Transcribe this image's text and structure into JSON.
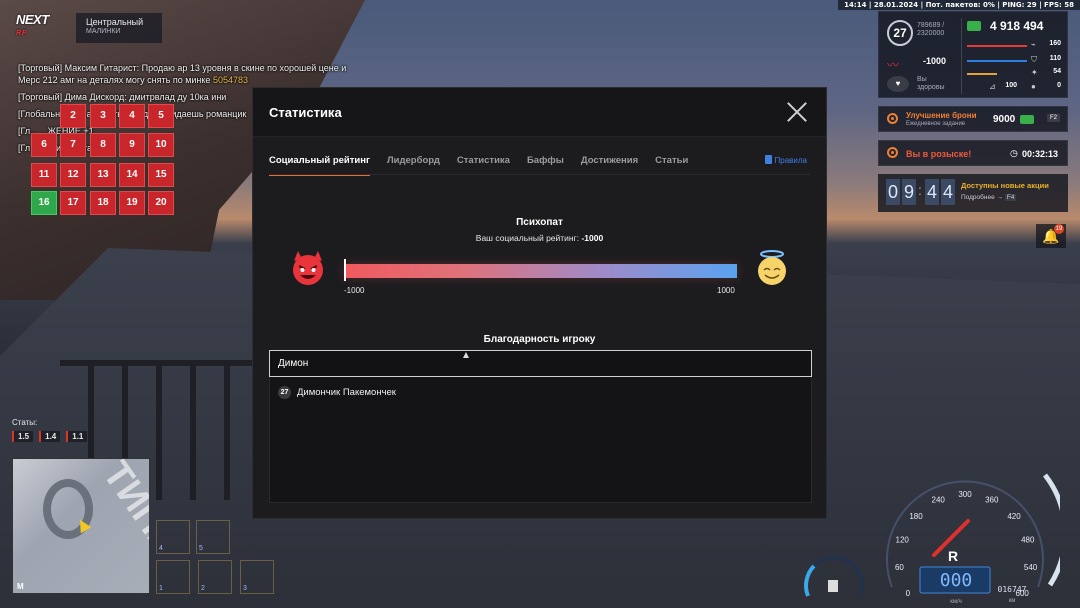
{
  "topbar": {
    "text": "14:14 | 28.01.2024 | Пот. пакетов: 0% | PING: 29 | FPS: 58"
  },
  "logo": {
    "text": "NEXT",
    "sub": "RP"
  },
  "location": {
    "name": "Центральный",
    "district": "МАЛИНКИ"
  },
  "chat": [
    {
      "text": "[Торговый] Максим Гитарист: Продаю ар 13 уровня в скине по хорошей цене и Мерс 212 амг на деталях могу снять по минке ",
      "highlight": "5054783"
    },
    {
      "text": "[Торговый] Дима Дискорд: дмитрвлад ду 10ка ини",
      "highlight": ""
    },
    {
      "text": "[Глобальный] ... атрий ты три дня у кидаешь романцик",
      "highlight": ""
    },
    {
      "text": "[Гл... ...ЖЕНИЕ +1",
      "highlight": ""
    },
    {
      "text": "[Гл... ...ский поставил",
      "highlight": ""
    }
  ],
  "advent": {
    "days": [
      "2",
      "3",
      "4",
      "5",
      "6",
      "7",
      "8",
      "9",
      "10",
      "11",
      "12",
      "13",
      "14",
      "15",
      "16",
      "17",
      "18",
      "19",
      "20"
    ],
    "active_day": "16"
  },
  "stats_left": {
    "label": "Статы:",
    "values": [
      "1.5",
      "1.4",
      "1.1"
    ]
  },
  "minimap": {
    "letter": "М",
    "map_text": "ТИПАЛ"
  },
  "hotkeys": [
    "4",
    "5",
    "1",
    "2",
    "3"
  ],
  "hud": {
    "level": "27",
    "xp": "789689 /",
    "xp_total": "2320000",
    "reputation": "-1000",
    "health_label": "Вы",
    "health_state": "здоровы",
    "money": "4 918 494",
    "stat1": "160",
    "stat2": "110",
    "stat3": "54",
    "stat4": "100",
    "stat5": "0",
    "accent": "#f08033",
    "money_color": "#38b04a"
  },
  "cards": {
    "armor_title": "Улучшение брони",
    "armor_sub": "Ежедневное задание",
    "armor_reward": "9000",
    "armor_key": "F2",
    "wanted_title": "Вы в розыске!",
    "wanted_time": "00:32:13"
  },
  "timer": {
    "digits": [
      "0",
      "9",
      "4",
      "4"
    ],
    "promo_title": "Доступны новые акции",
    "promo_sub": "Подробнее →",
    "promo_key": "F4"
  },
  "bell": {
    "count": "19"
  },
  "speedometer": {
    "ticks": [
      "0",
      "60",
      "120",
      "180",
      "240",
      "300",
      "360",
      "420",
      "480",
      "540",
      "600"
    ],
    "gear": "R",
    "speed": "000",
    "speed_unit": "км/ч",
    "odometer": "016747",
    "odometer_unit": "км"
  },
  "modal": {
    "title": "Статистика",
    "tabs": [
      "Социальный рейтинг",
      "Лидерборд",
      "Статистика",
      "Баффы",
      "Достижения",
      "Статьи"
    ],
    "active_tab": 0,
    "rules_label": "Правила",
    "rating": {
      "title": "Психопат",
      "subtitle": "Ваш социальный рейтинг:",
      "value": "-1000",
      "min": "-1000",
      "max": "1000",
      "position": 0.0
    },
    "gratitude": {
      "title": "Благодарность игроку",
      "input_value": "Димон",
      "results": [
        {
          "level": "27",
          "name": "Димончик Пакемончек"
        }
      ]
    }
  }
}
